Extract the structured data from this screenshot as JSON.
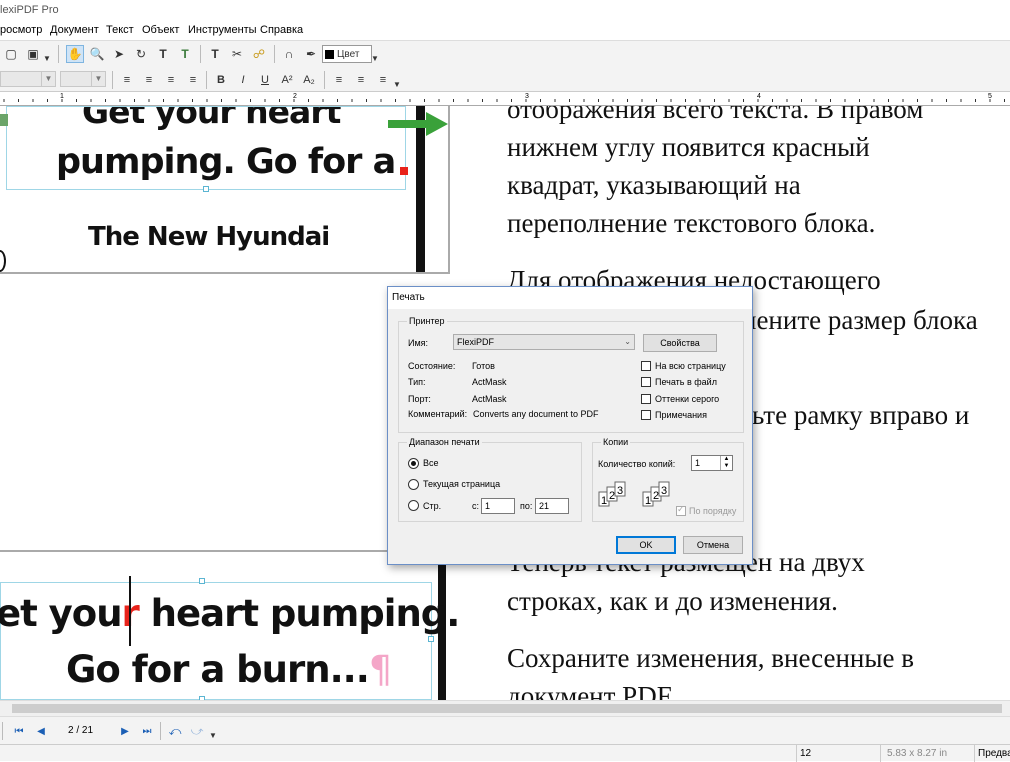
{
  "app": {
    "title": "lexiPDF Pro"
  },
  "menu": [
    "росмотр",
    "Документ",
    "Текст",
    "Объект",
    "Инструменты",
    "Справка"
  ],
  "toolbar": {
    "color_label": "Цвет"
  },
  "ruler": {
    "ticks": [
      "1",
      "2",
      "3",
      "4",
      "5"
    ]
  },
  "canvas": {
    "top_frame": {
      "line1": "Get your heart",
      "line2": "pumping. Go for a",
      "line3": "The New Hyundai"
    },
    "bottom_frame": {
      "line1_a": "et you",
      "line1_r": "r",
      "line1_b": " heart pumping.",
      "line2": "Go for a burn...",
      "pilcrow": "¶"
    },
    "right_text": [
      "отображения всего текста. В правом",
      "нижнем углу появится красный",
      "квадрат, указывающий на",
      "переполнение текстового блока.",
      "Для отображения недостающего",
      "нените размер блока",
      "ьте рамку вправо и",
      "Теперь текст размещен на двух",
      "строках, как и до изменения.",
      "Сохраните изменения, внесенные в",
      "документ PDF."
    ]
  },
  "dialog": {
    "title": "Печать",
    "printer_group": "Принтер",
    "name_label": "Имя:",
    "name_value": "FlexiPDF",
    "properties_button": "Свойства",
    "state_label": "Состояние:",
    "state_value": "Готов",
    "type_label": "Тип:",
    "type_value": "ActMask",
    "port_label": "Порт:",
    "port_value": "ActMask",
    "comment_label": "Комментарий:",
    "comment_value": "Converts any document to PDF",
    "checkboxes": [
      "На всю страницу",
      "Печать в файл",
      "Оттенки серого",
      "Примечания"
    ],
    "range_group": "Диапазон печати",
    "range_all": "Все",
    "range_current": "Текущая страница",
    "range_pages": "Стр.",
    "from_label": "с:",
    "from_value": "1",
    "to_label": "по:",
    "to_value": "21",
    "copies_group": "Копии",
    "copies_label": "Количество копий:",
    "copies_value": "1",
    "collate_label": "По порядку",
    "ok_button": "OK",
    "cancel_button": "Отмена"
  },
  "nav": {
    "page_indicator": "2 / 21"
  },
  "status": {
    "zoom": "12",
    "page_size": "5.83 x 8.27 in",
    "mode": "Предва"
  },
  "colors": {
    "accent_red": "#e8231b",
    "pilcrow_pink": "#f4a6c8",
    "frame_cyan": "#9fd6e6",
    "green_arrow": "#3aa13a",
    "dialog_border": "#6b8fc7",
    "default_button": "#0078d7"
  }
}
